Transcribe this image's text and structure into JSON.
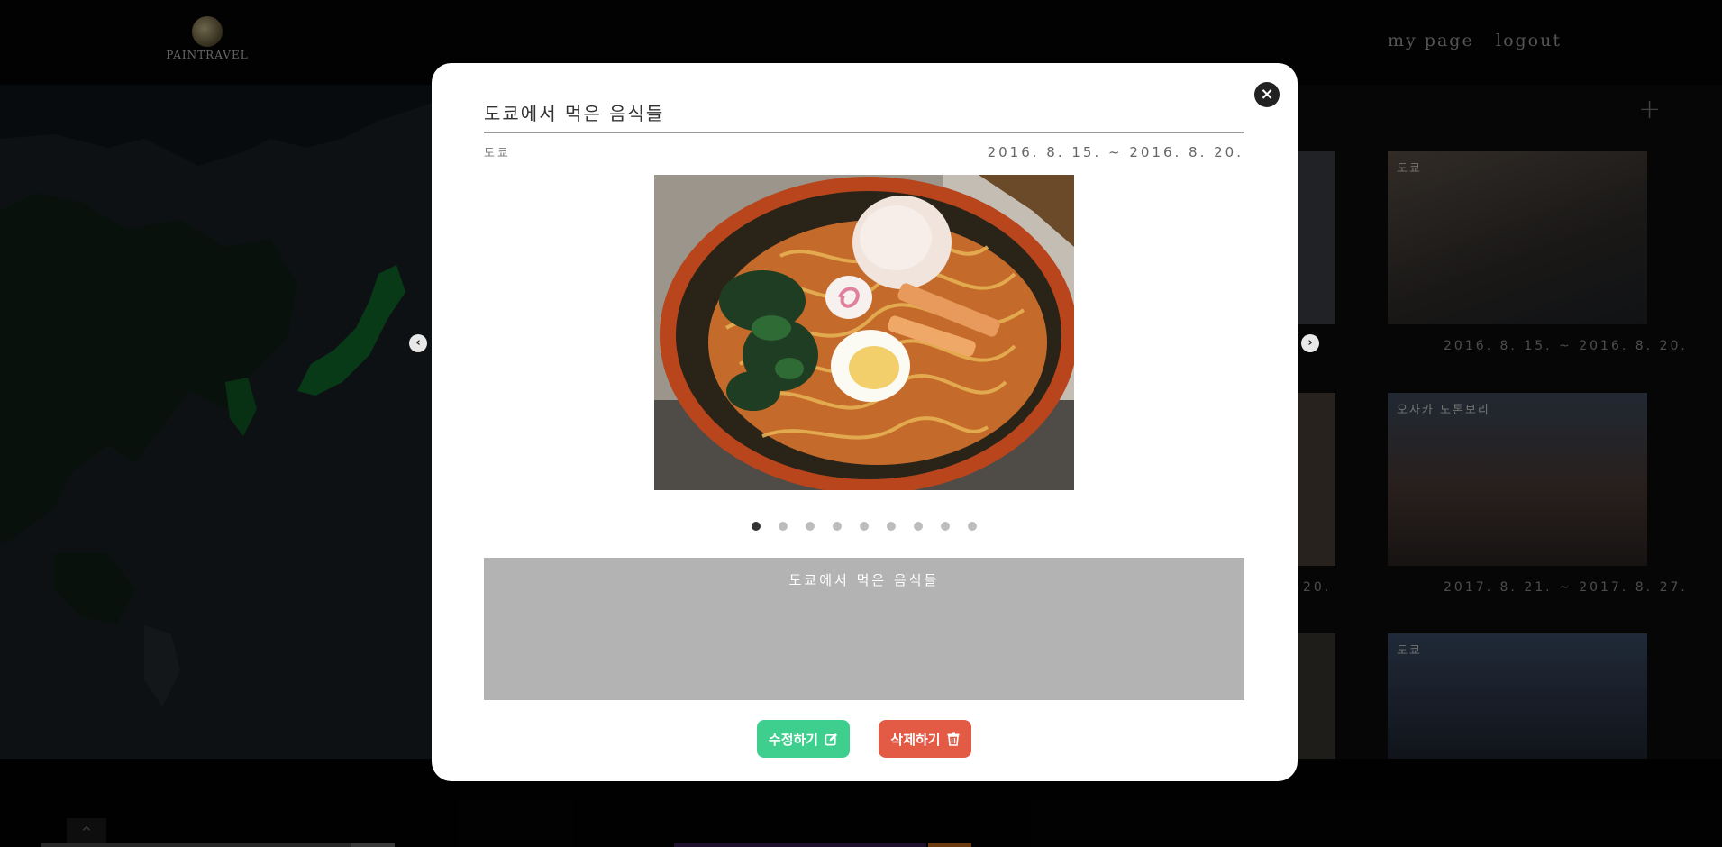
{
  "header": {
    "logo_text": "PAINTRAVEL",
    "nav": [
      {
        "label": "my page"
      },
      {
        "label": "logout"
      }
    ]
  },
  "gallery": {
    "add_label": "+",
    "cards": [
      {
        "label": "도쿄",
        "date": "2016. 8. 15. ~ 2016. 8. 20."
      },
      {
        "label": "오사카 도톤보리",
        "date": "2017. 8. 21. ~ 2017. 8. 27."
      },
      {
        "label": "도쿄",
        "date": ""
      }
    ],
    "partial_dates": [
      "0.",
      "20."
    ]
  },
  "modal": {
    "title": "도쿄에서 먹은 음식들",
    "location": "도쿄",
    "dates": "2016. 8. 15.  ~  2016. 8. 20.",
    "description": "도쿄에서 먹은 음식들",
    "photo_count": 9,
    "active_photo_index": 0,
    "close_label": "×",
    "prev_label": "‹",
    "next_label": "›",
    "edit_button": "수정하기",
    "delete_button": "삭제하기"
  },
  "colors": {
    "edit": "#3ecf8e",
    "delete": "#e35a45",
    "description_bg": "#b3b3b3"
  },
  "up_tab_label": "^"
}
